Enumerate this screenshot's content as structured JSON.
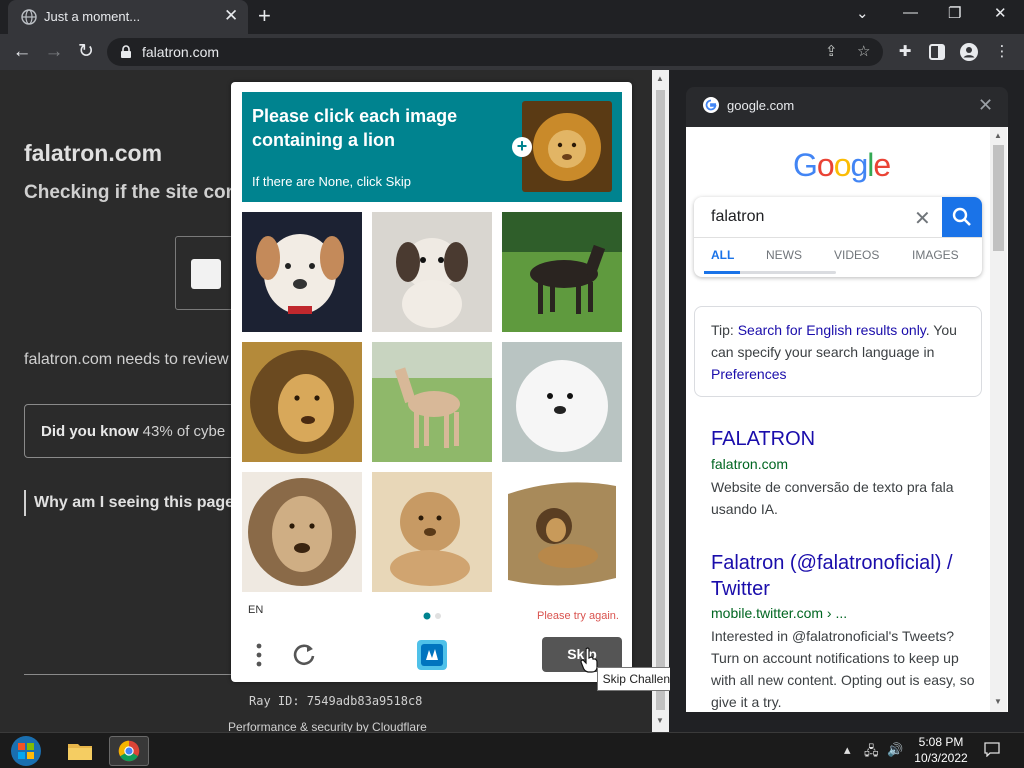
{
  "browser": {
    "tab_title": "Just a moment...",
    "url": "falatron.com"
  },
  "page": {
    "site_title": "falatron.com",
    "checking_text": "Checking if the site cor",
    "needs_review_text": "falatron.com needs to review",
    "did_you_know_bold": "Did you know",
    "did_you_know_rest": " 43% of cybe",
    "why_text": "Why am I seeing this page?",
    "ray_id": "Ray ID: 7549adb83a9518c8",
    "performance_text": "Performance & security by Cloudflare"
  },
  "captcha": {
    "prompt": "Please click each image containing a lion",
    "hint": "If there are None, click Skip",
    "language": "EN",
    "error": "Please try again.",
    "skip_label": "Skip",
    "tooltip": "Skip Challenge",
    "tiles": [
      {
        "subject": "dog"
      },
      {
        "subject": "dog"
      },
      {
        "subject": "horse"
      },
      {
        "subject": "lion"
      },
      {
        "subject": "horse"
      },
      {
        "subject": "dog"
      },
      {
        "subject": "lion"
      },
      {
        "subject": "lion"
      },
      {
        "subject": "lion"
      }
    ]
  },
  "side_panel": {
    "domain": "google.com",
    "logo_text": "Google",
    "query": "falatron",
    "tabs": [
      "ALL",
      "NEWS",
      "VIDEOS",
      "IMAGES"
    ],
    "tip_prefix": "Tip: ",
    "tip_link": "Search for English results only",
    "tip_middle": ". You can specify your search language in ",
    "tip_link2": "Preferences",
    "results": [
      {
        "title": "FALATRON",
        "url": "falatron.com",
        "description": "Website de conversão de texto pra fala usando IA."
      },
      {
        "title": "Falatron (@falatronoficial) / Twitter",
        "url": "mobile.twitter.com › ...",
        "description": "Interested in @falatronoficial's Tweets? Turn on account notifications to keep up with all new content. Opting out is easy, so give it a try."
      }
    ]
  },
  "taskbar": {
    "time": "5:08 PM",
    "date": "10/3/2022"
  },
  "colors": {
    "captcha_header": "#00838f",
    "google_blue": "#1a73e8",
    "link": "#1a0dab",
    "url_green": "#006621",
    "error_red": "#d9534f"
  }
}
